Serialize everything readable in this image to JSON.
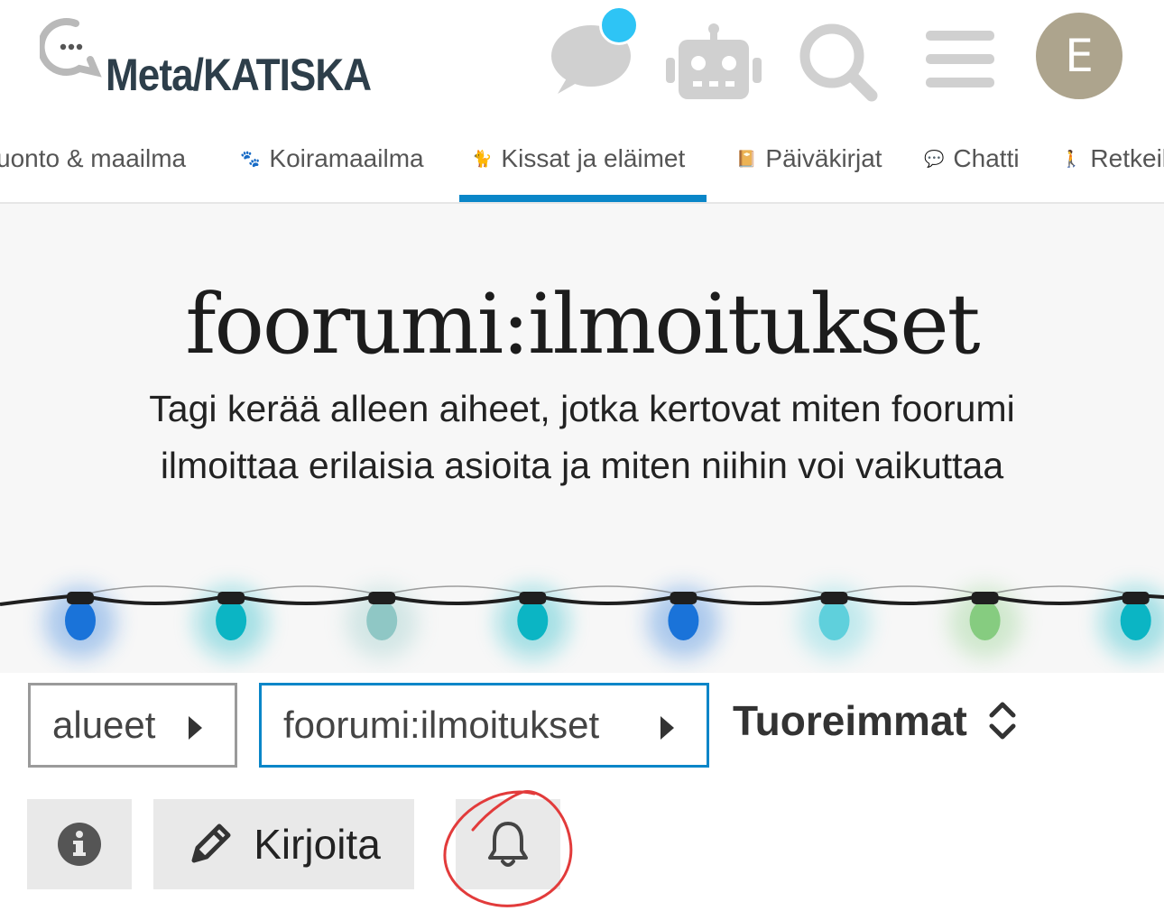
{
  "header": {
    "site_name": "Meta/KATISKA",
    "icons": [
      "chat-icon",
      "robot-icon",
      "search-icon",
      "hamburger-menu-icon"
    ],
    "avatar_letter": "E",
    "badge_color": "#2ec4f5"
  },
  "nav": {
    "items": [
      {
        "label": "Luonto & maailma",
        "icon": "",
        "visible_text": "uonto & maailma"
      },
      {
        "label": "Koiramaailma",
        "icon": "🐾"
      },
      {
        "label": "Kissat ja eläimet",
        "icon": "🐈",
        "active": true
      },
      {
        "label": "Päiväkirjat",
        "icon": "📔"
      },
      {
        "label": "Chatti",
        "icon": "💬"
      },
      {
        "label": "Retkeil",
        "icon": "🚶"
      }
    ],
    "accent_color": "#0a86c8"
  },
  "banner": {
    "title": "foorumi:ilmoitukset",
    "description": "Tagi kerää alleen aiheet, jotka kertovat miten foorumi ilmoittaa erilaisia asioita ja miten niihin voi vaikuttaa",
    "light_colors": [
      "#1a73d9",
      "#0bb5c4",
      "#8fc7c5",
      "#0bb5c4",
      "#1a73d9",
      "#5fd0dc",
      "#86cc80",
      "#0bb5c4"
    ]
  },
  "controls": {
    "breadcrumb_category": "alueet",
    "breadcrumb_tag": "foorumi:ilmoitukset",
    "sort_label": "Tuoreimmat"
  },
  "actions": {
    "info_icon": "info-icon",
    "write_label": "Kirjoita",
    "bell_icon": "bell-icon"
  }
}
